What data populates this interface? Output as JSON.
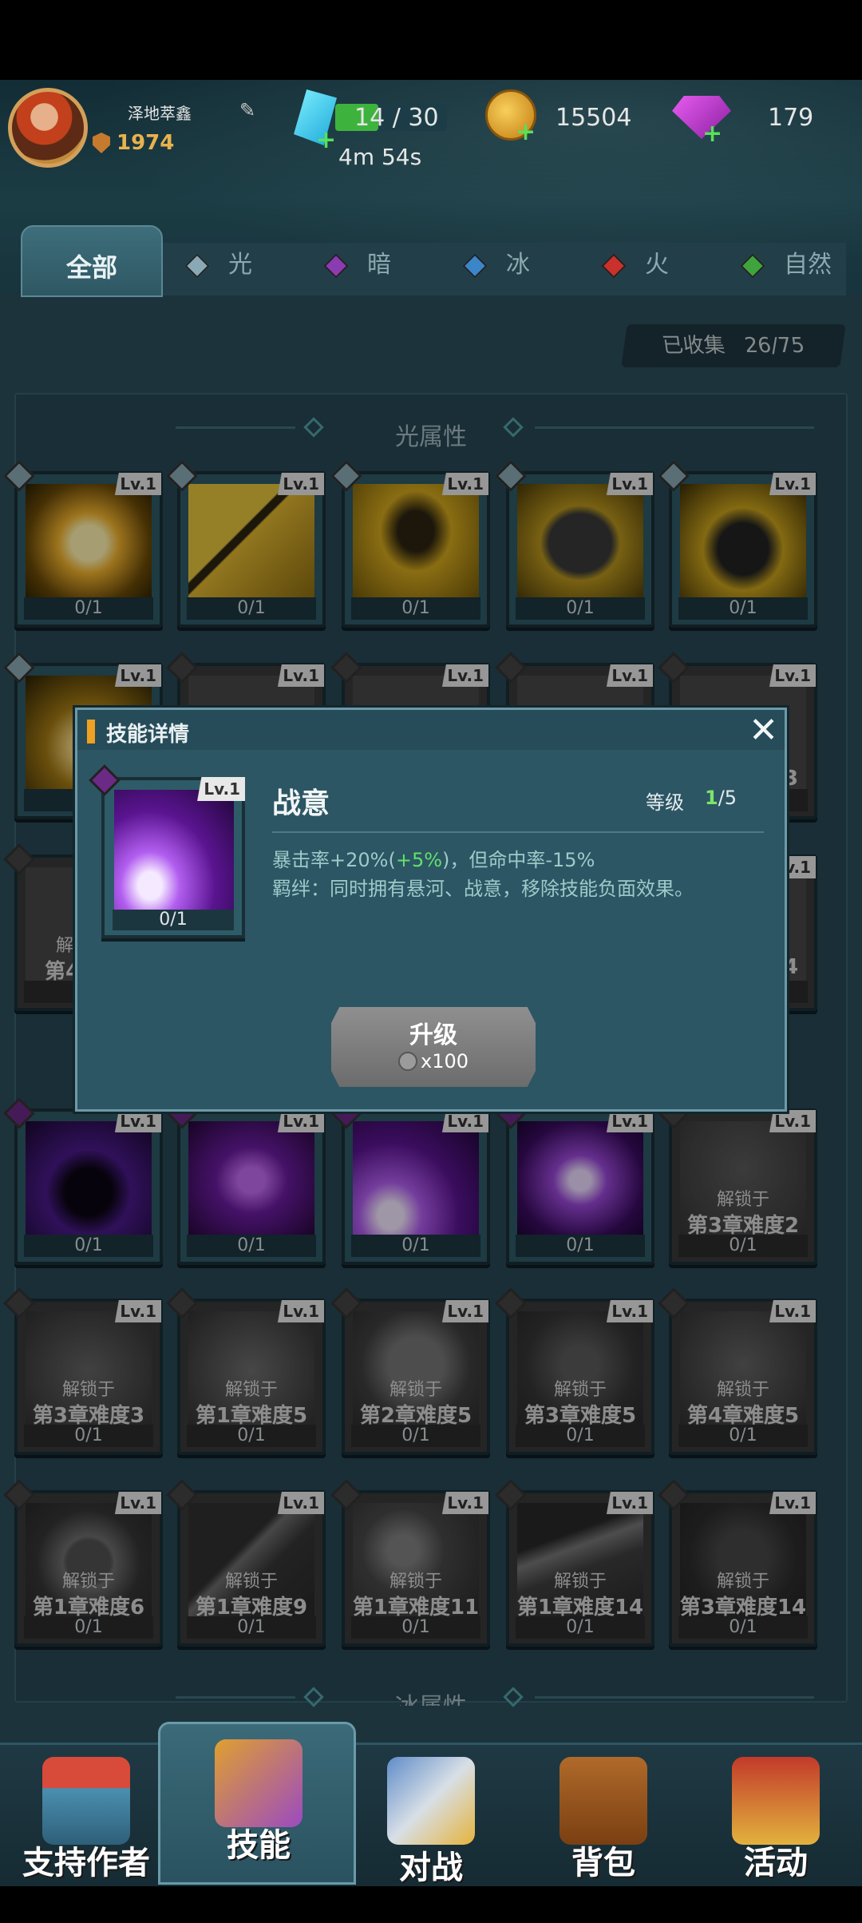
{
  "header": {
    "player_name": "泽地萃鑫",
    "rank": "1974",
    "energy": "14 / 30",
    "energy_timer": "4m 54s",
    "coins": "15504",
    "gems": "179"
  },
  "tabs": [
    "全部",
    "光",
    "暗",
    "冰",
    "火",
    "自然"
  ],
  "collected": {
    "label": "已收集",
    "value": "26/75"
  },
  "sections": {
    "light": "光属性",
    "ice": "冰属性"
  },
  "card_common": {
    "level": "Lv.1",
    "count": "0/1",
    "unlock_prefix": "解锁于"
  },
  "locked_cards": [
    "第3章难度2",
    "第3章难度3",
    "第1章难度5",
    "第2章难度5",
    "第3章难度5",
    "第4章难度5",
    "第1章难度6",
    "第1章难度9",
    "第1章难度11",
    "第1章难度14",
    "第3章难度14"
  ],
  "partial_text": {
    "left_row3_a": "解",
    "left_row3_b": "第4章",
    "right_row2": "3",
    "right_row3": "4"
  },
  "modal": {
    "title": "技能详情",
    "close_icon": "close-icon",
    "skill": {
      "name": "战意",
      "level_label": "等级",
      "level_current": "1",
      "level_max": "/5",
      "card_level": "Lv.1",
      "card_count": "0/1",
      "desc_a": "暴击率+20%(",
      "desc_bonus": "+5%",
      "desc_b": ")，但命中率-15%",
      "desc_line2": "羁绊：同时拥有悬河、战意，移除技能负面效果。"
    },
    "upgrade": {
      "label": "升级",
      "cost": "x100"
    }
  },
  "bottom_nav": [
    "支持作者",
    "技能",
    "对战",
    "背包",
    "活动"
  ],
  "colors": {
    "accent_orange": "#f0a022",
    "bonus_green": "#62e06c",
    "level_green": "#7ee36b",
    "panel_teal": "#2c5664"
  }
}
